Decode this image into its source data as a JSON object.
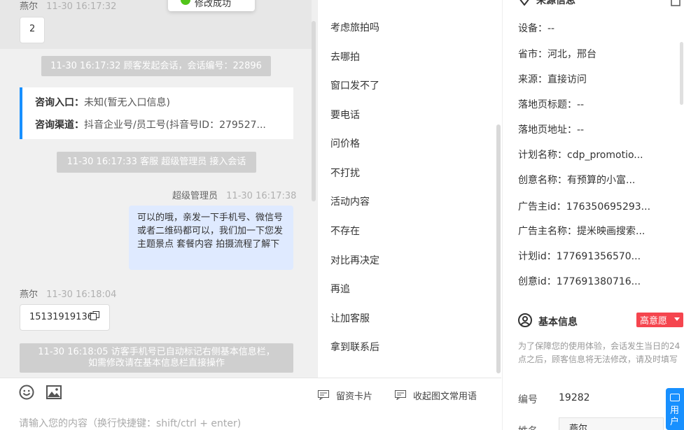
{
  "toast": {
    "text": "修改成功"
  },
  "chat": {
    "messages": [
      {
        "name": "燕尔",
        "time": "11-30 16:17:32",
        "content": "2"
      },
      {
        "name": "燕尔",
        "time": "11-30 16:18:04",
        "content": "15131919136"
      }
    ],
    "system_notices": [
      "11-30 16:17:32 顾客发起会话，会话编号：22896",
      "11-30 16:17:33 客服 超级管理员 接入会话",
      "11-30 16:18:05 访客手机号已自动标记右侧基本信息栏，",
      "如需修改请在基本信息栏直接操作"
    ],
    "info_card": {
      "entry_label": "咨询入口：",
      "entry_value": "未知(暂无入口信息)",
      "channel_label": "咨询渠道：",
      "channel_value": "抖音企业号/员工号(抖音号ID：279527..."
    },
    "agent": {
      "name": "超级管理员",
      "time": "11-30 16:17:38",
      "content": "可以的哦，亲发一下手机号、微信号或者二维码都可以，我们加一下您发主题景点 套餐内容 拍摄流程了解下"
    }
  },
  "composer": {
    "lead_card_label": "留资卡片",
    "collapse_label": "收起图文常用语",
    "placeholder": "请输入您的内容（换行快捷键：shift/ctrl + enter)"
  },
  "phrases": {
    "items": [
      "考虑旅拍吗",
      "去哪拍",
      "窗口发不了",
      "要电话",
      "问价格",
      "不打扰",
      "活动内容",
      "不存在",
      "对比再决定",
      "再追",
      "让加客服",
      "拿到联系后"
    ]
  },
  "source_info": {
    "title": "来源信息",
    "rows": [
      {
        "label": "设备：",
        "value": "--"
      },
      {
        "label": "省市：",
        "value": "河北，邢台"
      },
      {
        "label": "来源：",
        "value": "直接访问"
      },
      {
        "label": "落地页标题：",
        "value": "--"
      },
      {
        "label": "落地页地址：",
        "value": "--"
      },
      {
        "label": "计划名称：",
        "value": "cdp_promotio..."
      },
      {
        "label": "创意名称：",
        "value": "有预算的小富..."
      },
      {
        "label": "广告主id：",
        "value": "176350695293..."
      },
      {
        "label": "广告主名称：",
        "value": "提米映画搜索..."
      },
      {
        "label": "计划id：",
        "value": "177691356570..."
      },
      {
        "label": "创意id：",
        "value": "177691380716..."
      }
    ]
  },
  "basic_info": {
    "title": "基本信息",
    "intent": "高意愿",
    "hint": "为了保障您的使用体验，会话发生当日的24点之后，顾客信息将无法修改，请及时填写",
    "id_label": "编号",
    "id_value": "19282",
    "name_label": "姓名",
    "name_value": "燕尔"
  },
  "side_tab": {
    "label": "用户"
  }
}
